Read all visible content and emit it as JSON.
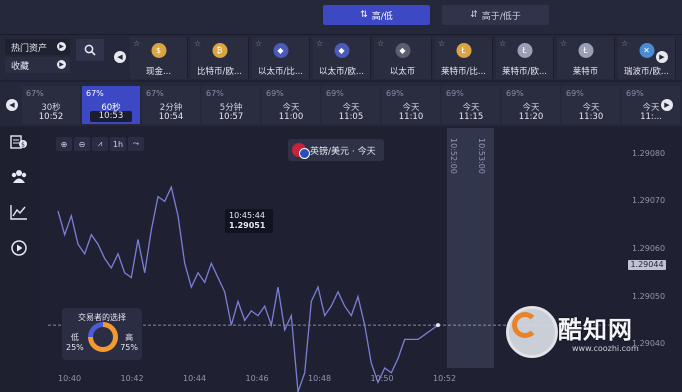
{
  "mode": {
    "high_low": "高/低",
    "touch": "高于/低于"
  },
  "asset_tabs": {
    "hot": "热门资产",
    "favorites": "收藏"
  },
  "assets": [
    {
      "name": "现金...",
      "logo_color": "#d9a441",
      "logo_glyph": "$"
    },
    {
      "name": "比特币/欧...",
      "logo_color": "#d9a441",
      "logo_glyph": "₿"
    },
    {
      "name": "以太币/比...",
      "logo_color": "#4a5ab8",
      "logo_glyph": "◆"
    },
    {
      "name": "以太币/欧...",
      "logo_color": "#4a5ab8",
      "logo_glyph": "◆"
    },
    {
      "name": "以太币",
      "logo_color": "#5a5e70",
      "logo_glyph": "◆"
    },
    {
      "name": "莱特币/比...",
      "logo_color": "#d9a441",
      "logo_glyph": "Ł"
    },
    {
      "name": "莱特币/欧...",
      "logo_color": "#9aa0b4",
      "logo_glyph": "Ł"
    },
    {
      "name": "莱特币",
      "logo_color": "#9aa0b4",
      "logo_glyph": "Ł"
    },
    {
      "name": "瑞波币/欧...",
      "logo_color": "#4a8cd4",
      "logo_glyph": "✕"
    }
  ],
  "expiries": [
    {
      "pct": "67%",
      "label": "30秒",
      "clock": "10:52",
      "selected": false
    },
    {
      "pct": "67%",
      "label": "60秒",
      "clock": "10:53",
      "selected": true
    },
    {
      "pct": "67%",
      "label": "2分钟",
      "clock": "10:54",
      "selected": false
    },
    {
      "pct": "67%",
      "label": "5分钟",
      "clock": "10:57",
      "selected": false
    },
    {
      "pct": "69%",
      "label": "今天",
      "clock": "11:00",
      "selected": false
    },
    {
      "pct": "69%",
      "label": "今天",
      "clock": "11:05",
      "selected": false
    },
    {
      "pct": "69%",
      "label": "今天",
      "clock": "11:10",
      "selected": false
    },
    {
      "pct": "69%",
      "label": "今天",
      "clock": "11:15",
      "selected": false
    },
    {
      "pct": "69%",
      "label": "今天",
      "clock": "11:20",
      "selected": false
    },
    {
      "pct": "69%",
      "label": "今天",
      "clock": "11:30",
      "selected": false
    },
    {
      "pct": "69%",
      "label": "今天",
      "clock": "11:...",
      "selected": false
    }
  ],
  "chart_tools": [
    "⊕",
    "⊖",
    "⩘",
    "1h",
    "⤳"
  ],
  "chart_title": "英镑/美元 · 今天",
  "tooltip": {
    "time": "10:45:44",
    "price": "1.29051"
  },
  "expiry_marks": [
    "10:52:00",
    "10:53:00"
  ],
  "current_price": "1.29044",
  "sentiment": {
    "title": "交易者的选择",
    "low_label": "低",
    "low_pct": "25%",
    "high_label": "高",
    "high_pct": "75%",
    "high_ratio": 0.75
  },
  "watermark": {
    "text": "酷知网",
    "url": "www.coozhi.com"
  },
  "chart_data": {
    "type": "line",
    "title": "英镑/美元 · 今天",
    "xlabel": "",
    "ylabel": "",
    "x_ticks": [
      "10:40",
      "10:42",
      "10:44",
      "10:46",
      "10:48",
      "10:50",
      "10:52"
    ],
    "y_ticks": [
      "1.29080",
      "1.29070",
      "1.29060",
      "1.29050",
      "1.29040"
    ],
    "ylim": [
      1.29035,
      1.29085
    ],
    "current_price": 1.29044,
    "series": [
      {
        "values": [
          1.29068,
          1.29063,
          1.29067,
          1.29061,
          1.29059,
          1.29063,
          1.29061,
          1.29058,
          1.29056,
          1.29059,
          1.29055,
          1.29054,
          1.29062,
          1.29055,
          1.29064,
          1.29071,
          1.2907,
          1.29073,
          1.29067,
          1.29057,
          1.29052,
          1.29055,
          1.29053,
          1.29057,
          1.29054,
          1.29051,
          1.29044,
          1.29049,
          1.29045,
          1.29047,
          1.29046,
          1.29048,
          1.29044,
          1.29052,
          1.29043,
          1.29046,
          1.2903,
          1.29034,
          1.29049,
          1.29052,
          1.29046,
          1.29048,
          1.29051,
          1.29048,
          1.29046,
          1.2905,
          1.29044,
          1.29036,
          1.29032,
          1.29035,
          1.29034,
          1.29037,
          1.29041,
          1.29041,
          1.29041,
          1.29042,
          1.29043,
          1.29044
        ]
      }
    ]
  }
}
